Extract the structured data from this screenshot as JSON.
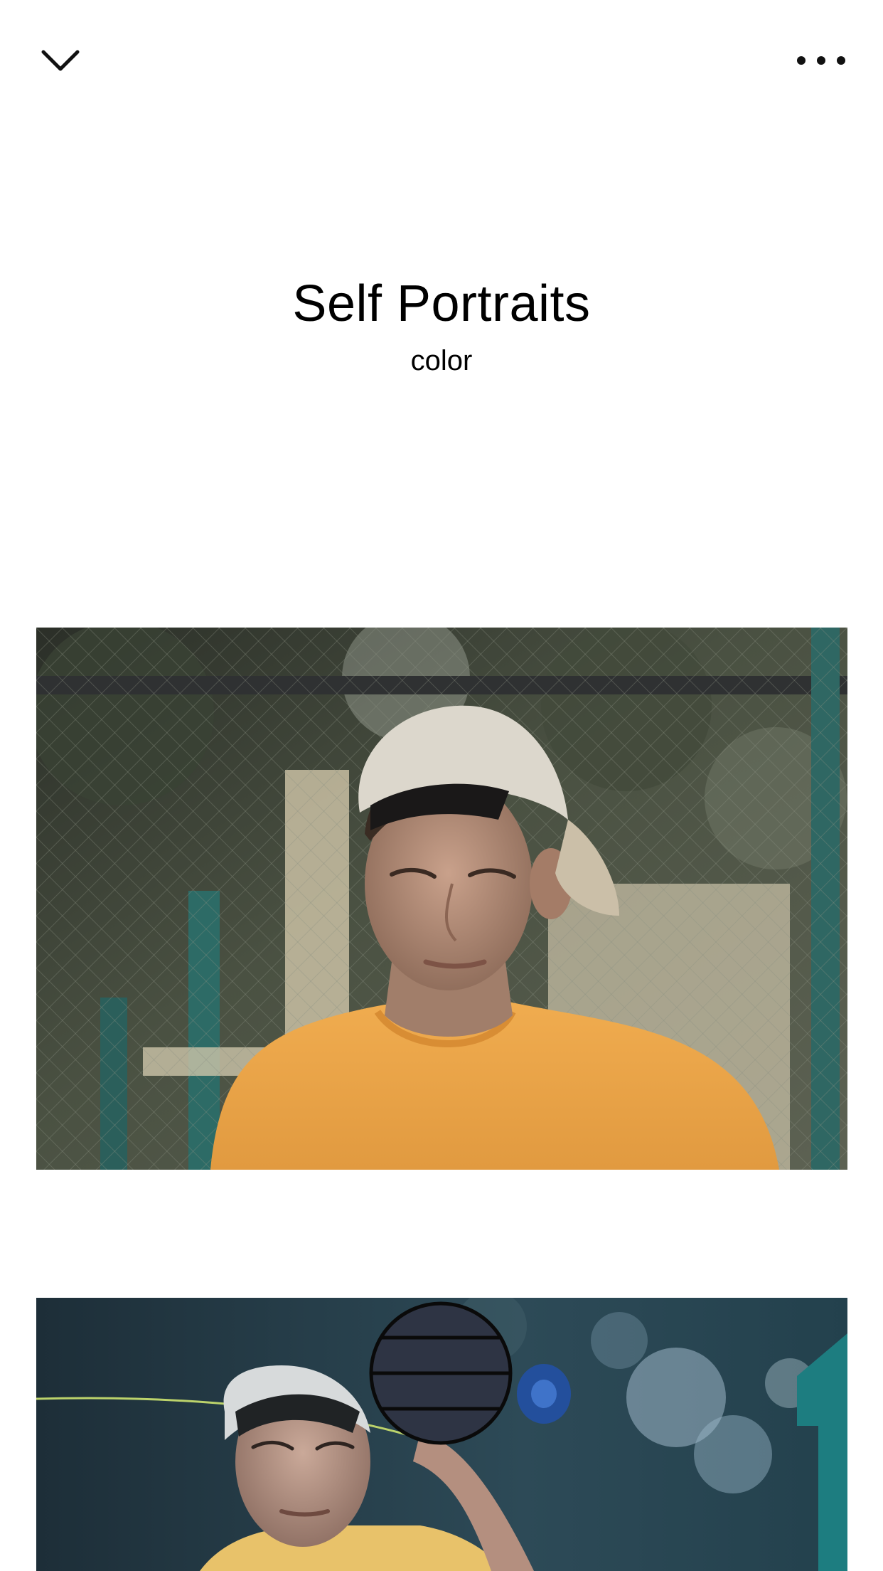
{
  "toolbar": {
    "back_icon": "chevron-down-icon",
    "menu_icon": "more-horizontal-icon"
  },
  "header": {
    "title": "Self Portraits",
    "subtitle": "color"
  },
  "photos": [
    {
      "name": "portrait-photo-1"
    },
    {
      "name": "portrait-photo-2"
    }
  ],
  "drag_handle": {
    "icon": "drag-handle-icon"
  }
}
